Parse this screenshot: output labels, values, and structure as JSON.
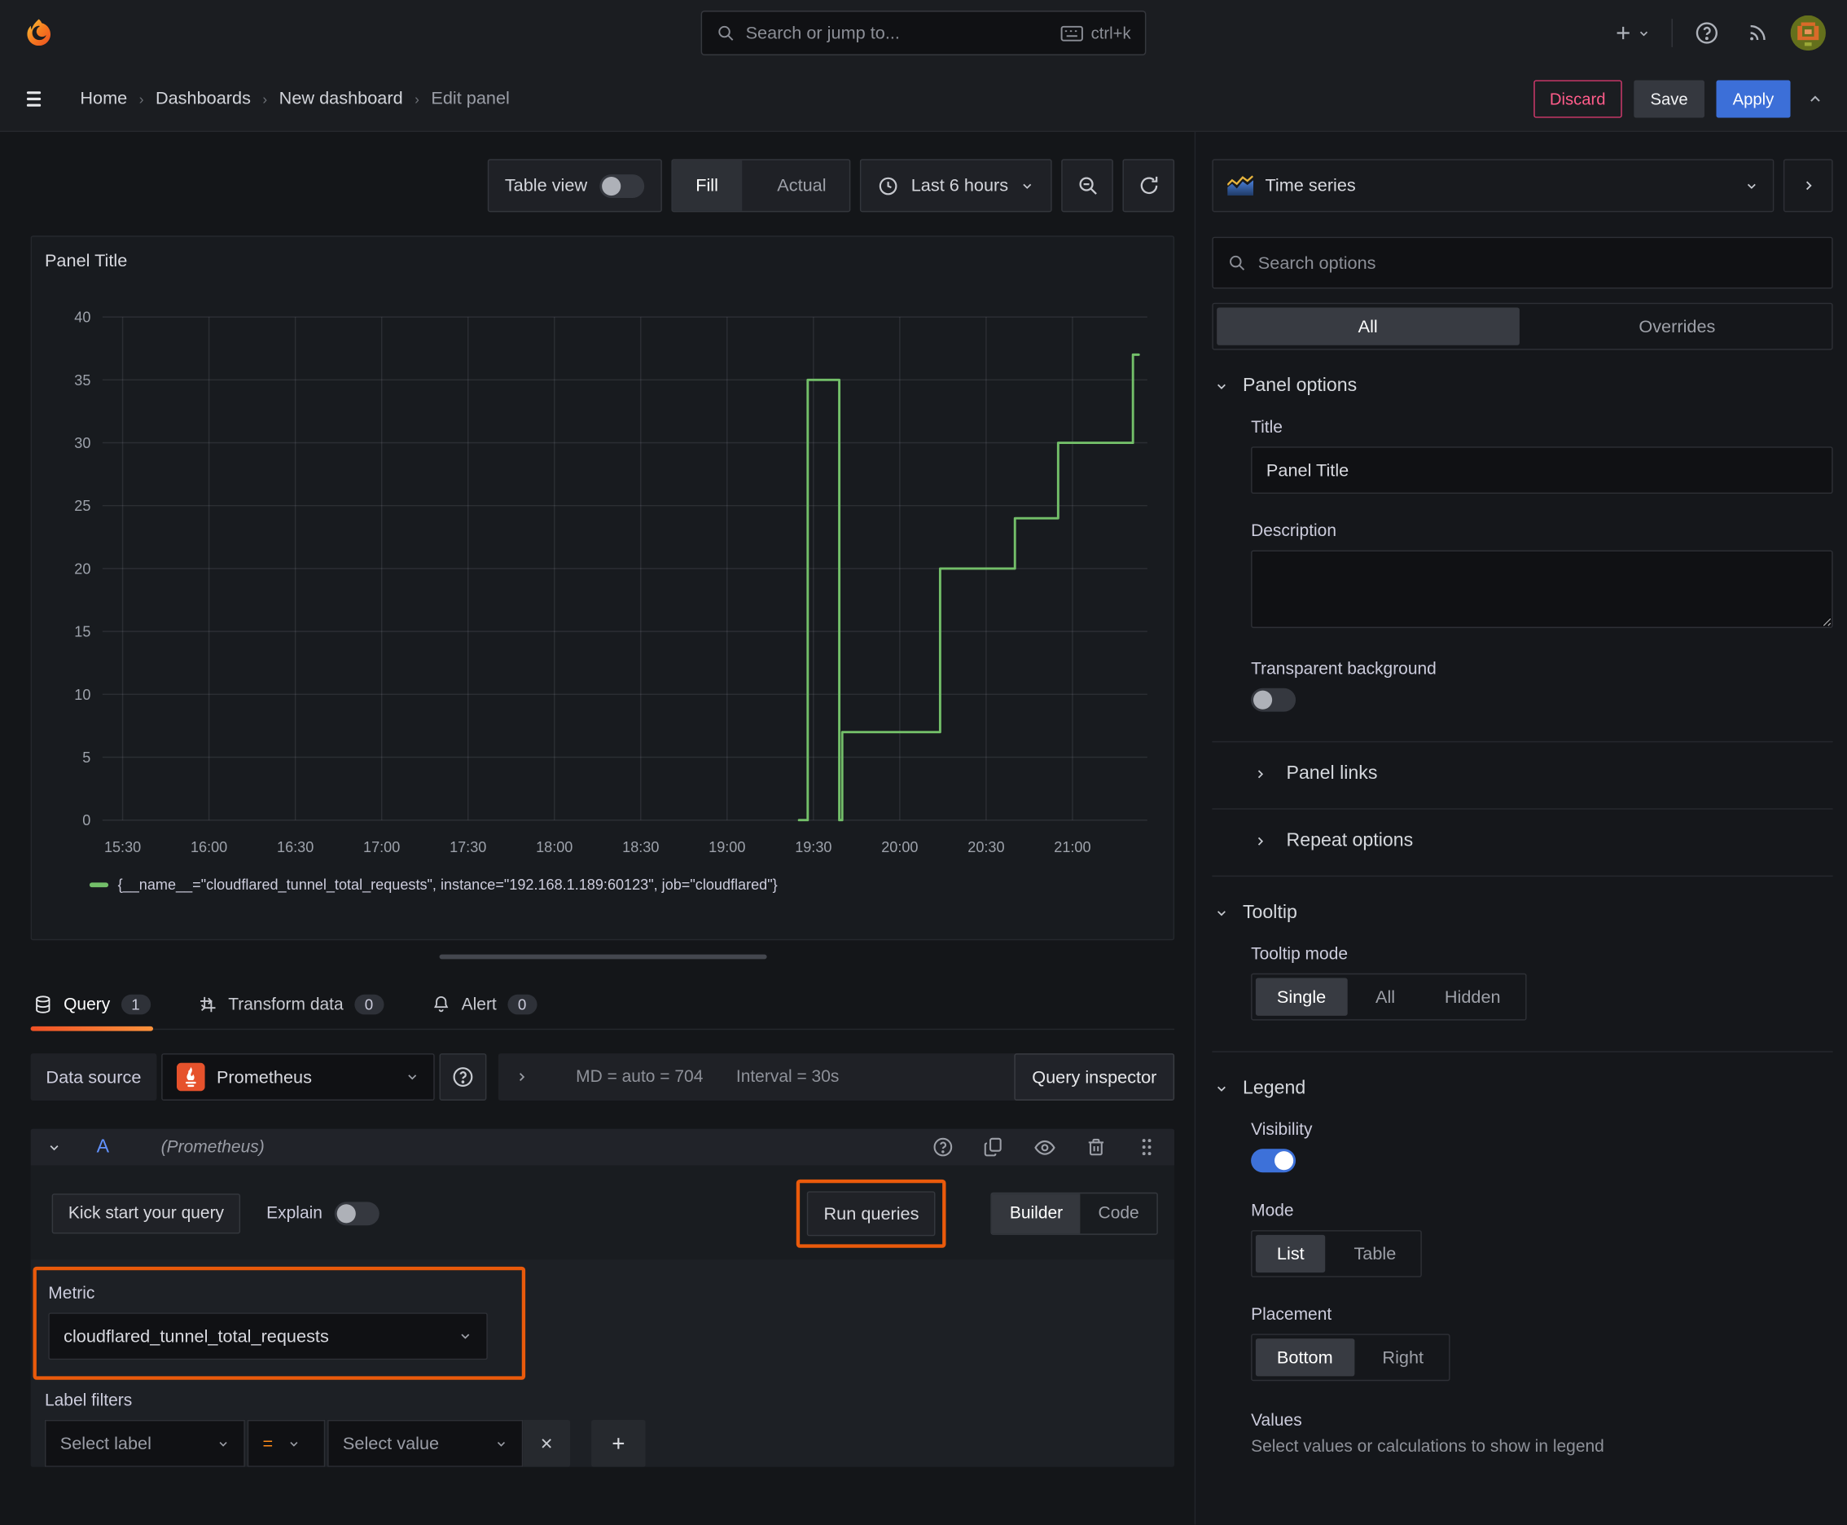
{
  "topbar": {
    "search_placeholder": "Search or jump to...",
    "shortcut": "ctrl+k"
  },
  "breadcrumb": {
    "items": [
      "Home",
      "Dashboards",
      "New dashboard",
      "Edit panel"
    ],
    "discard": "Discard",
    "save": "Save",
    "apply": "Apply"
  },
  "toolbar": {
    "table_view": "Table view",
    "fill": "Fill",
    "actual": "Actual",
    "time_range": "Last 6 hours"
  },
  "chart_data": {
    "type": "line",
    "title": "Panel Title",
    "step": true,
    "x_ticks": [
      "15:30",
      "16:00",
      "16:30",
      "17:00",
      "17:30",
      "18:00",
      "18:30",
      "19:00",
      "19:30",
      "20:00",
      "20:30",
      "21:00"
    ],
    "x_tick_minutes": [
      0,
      30,
      60,
      90,
      120,
      150,
      180,
      210,
      240,
      270,
      300,
      330
    ],
    "x_domain_minutes": [
      -7,
      356
    ],
    "ylim": [
      0,
      40
    ],
    "y_ticks": [
      0,
      5,
      10,
      15,
      20,
      25,
      30,
      35,
      40
    ],
    "grid": true,
    "legend_position": "bottom",
    "series": [
      {
        "name": "{__name__=\"cloudflared_tunnel_total_requests\", instance=\"192.168.1.189:60123\", job=\"cloudflared\"}",
        "color": "#73bf69",
        "points": [
          [
            235,
            0
          ],
          [
            238,
            0
          ],
          [
            238,
            35
          ],
          [
            249,
            35
          ],
          [
            249,
            0
          ],
          [
            250,
            0
          ],
          [
            250,
            7
          ],
          [
            284,
            7
          ],
          [
            284,
            20
          ],
          [
            310,
            20
          ],
          [
            310,
            24
          ],
          [
            325,
            24
          ],
          [
            325,
            30
          ],
          [
            351,
            30
          ],
          [
            351,
            37
          ],
          [
            353,
            37
          ]
        ]
      }
    ]
  },
  "tabs": {
    "query": "Query",
    "query_count": "1",
    "transform": "Transform data",
    "transform_count": "0",
    "alert": "Alert",
    "alert_count": "0"
  },
  "query_row": {
    "datasource_label": "Data source",
    "datasource": "Prometheus",
    "stats": "MD = auto = 704",
    "interval": "Interval = 30s",
    "inspector": "Query inspector"
  },
  "query_a": {
    "ref": "A",
    "hint": "(Prometheus)"
  },
  "query_actions": {
    "kick": "Kick start your query",
    "explain": "Explain",
    "run": "Run queries",
    "builder": "Builder",
    "code": "Code"
  },
  "metric": {
    "label": "Metric",
    "value": "cloudflared_tunnel_total_requests"
  },
  "filters": {
    "label": "Label filters",
    "select_label": "Select label",
    "op": "=",
    "select_value": "Select value"
  },
  "sidebar": {
    "viz": "Time series",
    "search_placeholder": "Search options",
    "tab_all": "All",
    "tab_overrides": "Overrides",
    "panel_options": "Panel options",
    "title_label": "Title",
    "title_value": "Panel Title",
    "description_label": "Description",
    "transparent": "Transparent background",
    "panel_links": "Panel links",
    "repeat_options": "Repeat options",
    "tooltip": "Tooltip",
    "tooltip_mode": "Tooltip mode",
    "single": "Single",
    "all": "All",
    "hidden": "Hidden",
    "legend": "Legend",
    "visibility": "Visibility",
    "mode": "Mode",
    "list": "List",
    "table": "Table",
    "placement": "Placement",
    "bottom": "Bottom",
    "right": "Right",
    "values": "Values",
    "values_help": "Select values or calculations to show in legend"
  },
  "colors": {
    "series_green": "#73bf69",
    "accent_blue": "#3d71d9",
    "annotation_orange": "#ea5a0b",
    "tab_orange": "#f05125",
    "discard_pink": "#ff5c8a"
  }
}
